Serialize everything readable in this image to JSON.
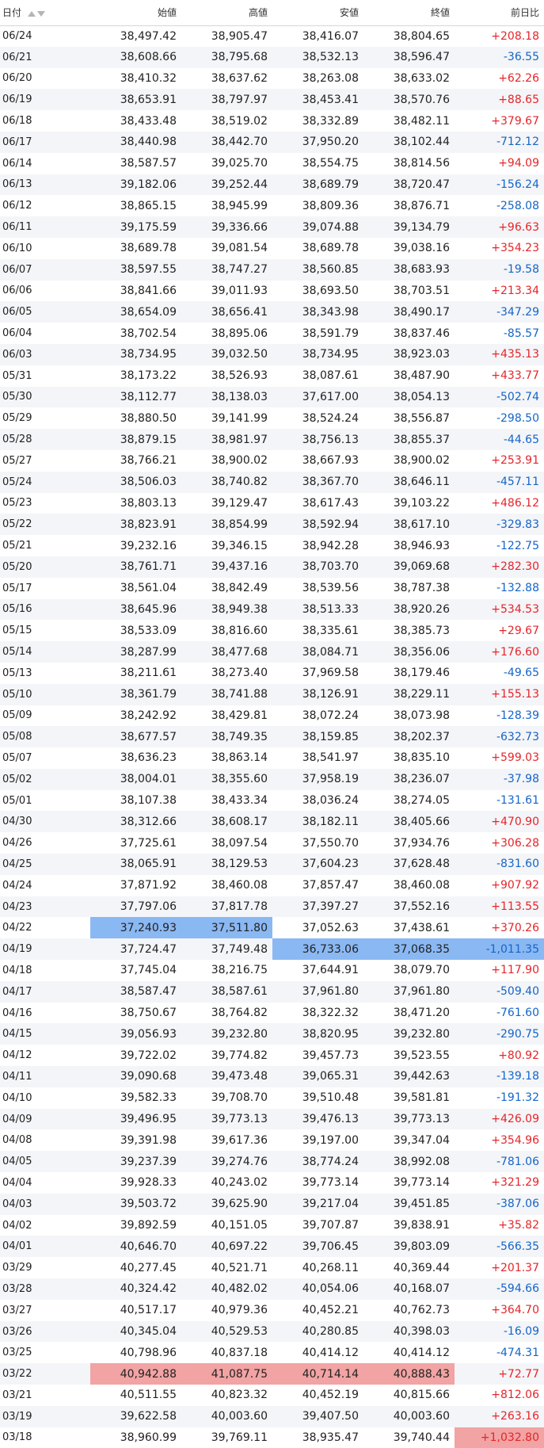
{
  "header": {
    "date": "日付",
    "open": "始値",
    "high": "高値",
    "low": "安値",
    "close": "終値",
    "change": "前日比"
  },
  "colors": {
    "up": "#e5252a",
    "down": "#1565c8",
    "highlight_blue": "#8ab8f3",
    "highlight_red": "#f2a3a3",
    "stripe": "#f4f5f8"
  },
  "rows": [
    {
      "date": "06/24",
      "open": "38,497.42",
      "high": "38,905.47",
      "low": "38,416.07",
      "close": "38,804.65",
      "change": "+208.18"
    },
    {
      "date": "06/21",
      "open": "38,608.66",
      "high": "38,795.68",
      "low": "38,532.13",
      "close": "38,596.47",
      "change": "-36.55"
    },
    {
      "date": "06/20",
      "open": "38,410.32",
      "high": "38,637.62",
      "low": "38,263.08",
      "close": "38,633.02",
      "change": "+62.26"
    },
    {
      "date": "06/19",
      "open": "38,653.91",
      "high": "38,797.97",
      "low": "38,453.41",
      "close": "38,570.76",
      "change": "+88.65"
    },
    {
      "date": "06/18",
      "open": "38,433.48",
      "high": "38,519.02",
      "low": "38,332.89",
      "close": "38,482.11",
      "change": "+379.67"
    },
    {
      "date": "06/17",
      "open": "38,440.98",
      "high": "38,442.70",
      "low": "37,950.20",
      "close": "38,102.44",
      "change": "-712.12"
    },
    {
      "date": "06/14",
      "open": "38,587.57",
      "high": "39,025.70",
      "low": "38,554.75",
      "close": "38,814.56",
      "change": "+94.09"
    },
    {
      "date": "06/13",
      "open": "39,182.06",
      "high": "39,252.44",
      "low": "38,689.79",
      "close": "38,720.47",
      "change": "-156.24"
    },
    {
      "date": "06/12",
      "open": "38,865.15",
      "high": "38,945.99",
      "low": "38,809.36",
      "close": "38,876.71",
      "change": "-258.08"
    },
    {
      "date": "06/11",
      "open": "39,175.59",
      "high": "39,336.66",
      "low": "39,074.88",
      "close": "39,134.79",
      "change": "+96.63"
    },
    {
      "date": "06/10",
      "open": "38,689.78",
      "high": "39,081.54",
      "low": "38,689.78",
      "close": "39,038.16",
      "change": "+354.23"
    },
    {
      "date": "06/07",
      "open": "38,597.55",
      "high": "38,747.27",
      "low": "38,560.85",
      "close": "38,683.93",
      "change": "-19.58"
    },
    {
      "date": "06/06",
      "open": "38,841.66",
      "high": "39,011.93",
      "low": "38,693.50",
      "close": "38,703.51",
      "change": "+213.34"
    },
    {
      "date": "06/05",
      "open": "38,654.09",
      "high": "38,656.41",
      "low": "38,343.98",
      "close": "38,490.17",
      "change": "-347.29"
    },
    {
      "date": "06/04",
      "open": "38,702.54",
      "high": "38,895.06",
      "low": "38,591.79",
      "close": "38,837.46",
      "change": "-85.57"
    },
    {
      "date": "06/03",
      "open": "38,734.95",
      "high": "39,032.50",
      "low": "38,734.95",
      "close": "38,923.03",
      "change": "+435.13"
    },
    {
      "date": "05/31",
      "open": "38,173.22",
      "high": "38,526.93",
      "low": "38,087.61",
      "close": "38,487.90",
      "change": "+433.77"
    },
    {
      "date": "05/30",
      "open": "38,112.77",
      "high": "38,138.03",
      "low": "37,617.00",
      "close": "38,054.13",
      "change": "-502.74"
    },
    {
      "date": "05/29",
      "open": "38,880.50",
      "high": "39,141.99",
      "low": "38,524.24",
      "close": "38,556.87",
      "change": "-298.50"
    },
    {
      "date": "05/28",
      "open": "38,879.15",
      "high": "38,981.97",
      "low": "38,756.13",
      "close": "38,855.37",
      "change": "-44.65"
    },
    {
      "date": "05/27",
      "open": "38,766.21",
      "high": "38,900.02",
      "low": "38,667.93",
      "close": "38,900.02",
      "change": "+253.91"
    },
    {
      "date": "05/24",
      "open": "38,506.03",
      "high": "38,740.82",
      "low": "38,367.70",
      "close": "38,646.11",
      "change": "-457.11"
    },
    {
      "date": "05/23",
      "open": "38,803.13",
      "high": "39,129.47",
      "low": "38,617.43",
      "close": "39,103.22",
      "change": "+486.12"
    },
    {
      "date": "05/22",
      "open": "38,823.91",
      "high": "38,854.99",
      "low": "38,592.94",
      "close": "38,617.10",
      "change": "-329.83"
    },
    {
      "date": "05/21",
      "open": "39,232.16",
      "high": "39,346.15",
      "low": "38,942.28",
      "close": "38,946.93",
      "change": "-122.75"
    },
    {
      "date": "05/20",
      "open": "38,761.71",
      "high": "39,437.16",
      "low": "38,703.70",
      "close": "39,069.68",
      "change": "+282.30"
    },
    {
      "date": "05/17",
      "open": "38,561.04",
      "high": "38,842.49",
      "low": "38,539.56",
      "close": "38,787.38",
      "change": "-132.88"
    },
    {
      "date": "05/16",
      "open": "38,645.96",
      "high": "38,949.38",
      "low": "38,513.33",
      "close": "38,920.26",
      "change": "+534.53"
    },
    {
      "date": "05/15",
      "open": "38,533.09",
      "high": "38,816.60",
      "low": "38,335.61",
      "close": "38,385.73",
      "change": "+29.67"
    },
    {
      "date": "05/14",
      "open": "38,287.99",
      "high": "38,477.68",
      "low": "38,084.71",
      "close": "38,356.06",
      "change": "+176.60"
    },
    {
      "date": "05/13",
      "open": "38,211.61",
      "high": "38,273.40",
      "low": "37,969.58",
      "close": "38,179.46",
      "change": "-49.65"
    },
    {
      "date": "05/10",
      "open": "38,361.79",
      "high": "38,741.88",
      "low": "38,126.91",
      "close": "38,229.11",
      "change": "+155.13"
    },
    {
      "date": "05/09",
      "open": "38,242.92",
      "high": "38,429.81",
      "low": "38,072.24",
      "close": "38,073.98",
      "change": "-128.39"
    },
    {
      "date": "05/08",
      "open": "38,677.57",
      "high": "38,749.35",
      "low": "38,159.85",
      "close": "38,202.37",
      "change": "-632.73"
    },
    {
      "date": "05/07",
      "open": "38,636.23",
      "high": "38,863.14",
      "low": "38,541.97",
      "close": "38,835.10",
      "change": "+599.03"
    },
    {
      "date": "05/02",
      "open": "38,004.01",
      "high": "38,355.60",
      "low": "37,958.19",
      "close": "38,236.07",
      "change": "-37.98"
    },
    {
      "date": "05/01",
      "open": "38,107.38",
      "high": "38,433.34",
      "low": "38,036.24",
      "close": "38,274.05",
      "change": "-131.61"
    },
    {
      "date": "04/30",
      "open": "38,312.66",
      "high": "38,608.17",
      "low": "38,182.11",
      "close": "38,405.66",
      "change": "+470.90"
    },
    {
      "date": "04/26",
      "open": "37,725.61",
      "high": "38,097.54",
      "low": "37,550.70",
      "close": "37,934.76",
      "change": "+306.28"
    },
    {
      "date": "04/25",
      "open": "38,065.91",
      "high": "38,129.53",
      "low": "37,604.23",
      "close": "37,628.48",
      "change": "-831.60"
    },
    {
      "date": "04/24",
      "open": "37,871.92",
      "high": "38,460.08",
      "low": "37,857.47",
      "close": "38,460.08",
      "change": "+907.92"
    },
    {
      "date": "04/23",
      "open": "37,797.06",
      "high": "37,817.78",
      "low": "37,397.27",
      "close": "37,552.16",
      "change": "+113.55"
    },
    {
      "date": "04/22",
      "open": "37,240.93",
      "high": "37,511.80",
      "low": "37,052.63",
      "close": "37,438.61",
      "change": "+370.26",
      "hl": {
        "open": "blue",
        "high": "blue"
      }
    },
    {
      "date": "04/19",
      "open": "37,724.47",
      "high": "37,749.48",
      "low": "36,733.06",
      "close": "37,068.35",
      "change": "-1,011.35",
      "hl": {
        "low": "blue",
        "close": "blue",
        "change": "blue"
      }
    },
    {
      "date": "04/18",
      "open": "37,745.04",
      "high": "38,216.75",
      "low": "37,644.91",
      "close": "38,079.70",
      "change": "+117.90"
    },
    {
      "date": "04/17",
      "open": "38,587.47",
      "high": "38,587.61",
      "low": "37,961.80",
      "close": "37,961.80",
      "change": "-509.40"
    },
    {
      "date": "04/16",
      "open": "38,750.67",
      "high": "38,764.82",
      "low": "38,322.32",
      "close": "38,471.20",
      "change": "-761.60"
    },
    {
      "date": "04/15",
      "open": "39,056.93",
      "high": "39,232.80",
      "low": "38,820.95",
      "close": "39,232.80",
      "change": "-290.75"
    },
    {
      "date": "04/12",
      "open": "39,722.02",
      "high": "39,774.82",
      "low": "39,457.73",
      "close": "39,523.55",
      "change": "+80.92"
    },
    {
      "date": "04/11",
      "open": "39,090.68",
      "high": "39,473.48",
      "low": "39,065.31",
      "close": "39,442.63",
      "change": "-139.18"
    },
    {
      "date": "04/10",
      "open": "39,582.33",
      "high": "39,708.70",
      "low": "39,510.48",
      "close": "39,581.81",
      "change": "-191.32"
    },
    {
      "date": "04/09",
      "open": "39,496.95",
      "high": "39,773.13",
      "low": "39,476.13",
      "close": "39,773.13",
      "change": "+426.09"
    },
    {
      "date": "04/08",
      "open": "39,391.98",
      "high": "39,617.36",
      "low": "39,197.00",
      "close": "39,347.04",
      "change": "+354.96"
    },
    {
      "date": "04/05",
      "open": "39,237.39",
      "high": "39,274.76",
      "low": "38,774.24",
      "close": "38,992.08",
      "change": "-781.06"
    },
    {
      "date": "04/04",
      "open": "39,928.33",
      "high": "40,243.02",
      "low": "39,773.14",
      "close": "39,773.14",
      "change": "+321.29"
    },
    {
      "date": "04/03",
      "open": "39,503.72",
      "high": "39,625.90",
      "low": "39,217.04",
      "close": "39,451.85",
      "change": "-387.06"
    },
    {
      "date": "04/02",
      "open": "39,892.59",
      "high": "40,151.05",
      "low": "39,707.87",
      "close": "39,838.91",
      "change": "+35.82"
    },
    {
      "date": "04/01",
      "open": "40,646.70",
      "high": "40,697.22",
      "low": "39,706.45",
      "close": "39,803.09",
      "change": "-566.35"
    },
    {
      "date": "03/29",
      "open": "40,277.45",
      "high": "40,521.71",
      "low": "40,268.11",
      "close": "40,369.44",
      "change": "+201.37"
    },
    {
      "date": "03/28",
      "open": "40,324.42",
      "high": "40,482.02",
      "low": "40,054.06",
      "close": "40,168.07",
      "change": "-594.66"
    },
    {
      "date": "03/27",
      "open": "40,517.17",
      "high": "40,979.36",
      "low": "40,452.21",
      "close": "40,762.73",
      "change": "+364.70"
    },
    {
      "date": "03/26",
      "open": "40,345.04",
      "high": "40,529.53",
      "low": "40,280.85",
      "close": "40,398.03",
      "change": "-16.09"
    },
    {
      "date": "03/25",
      "open": "40,798.96",
      "high": "40,837.18",
      "low": "40,414.12",
      "close": "40,414.12",
      "change": "-474.31"
    },
    {
      "date": "03/22",
      "open": "40,942.88",
      "high": "41,087.75",
      "low": "40,714.14",
      "close": "40,888.43",
      "change": "+72.77",
      "hl": {
        "open": "red",
        "high": "red",
        "low": "red",
        "close": "red"
      }
    },
    {
      "date": "03/21",
      "open": "40,511.55",
      "high": "40,823.32",
      "low": "40,452.19",
      "close": "40,815.66",
      "change": "+812.06"
    },
    {
      "date": "03/19",
      "open": "39,622.58",
      "high": "40,003.60",
      "low": "39,407.50",
      "close": "40,003.60",
      "change": "+263.16"
    },
    {
      "date": "03/18",
      "open": "38,960.99",
      "high": "39,769.11",
      "low": "38,935.47",
      "close": "39,740.44",
      "change": "+1,032.80",
      "hl": {
        "change": "red"
      }
    }
  ]
}
